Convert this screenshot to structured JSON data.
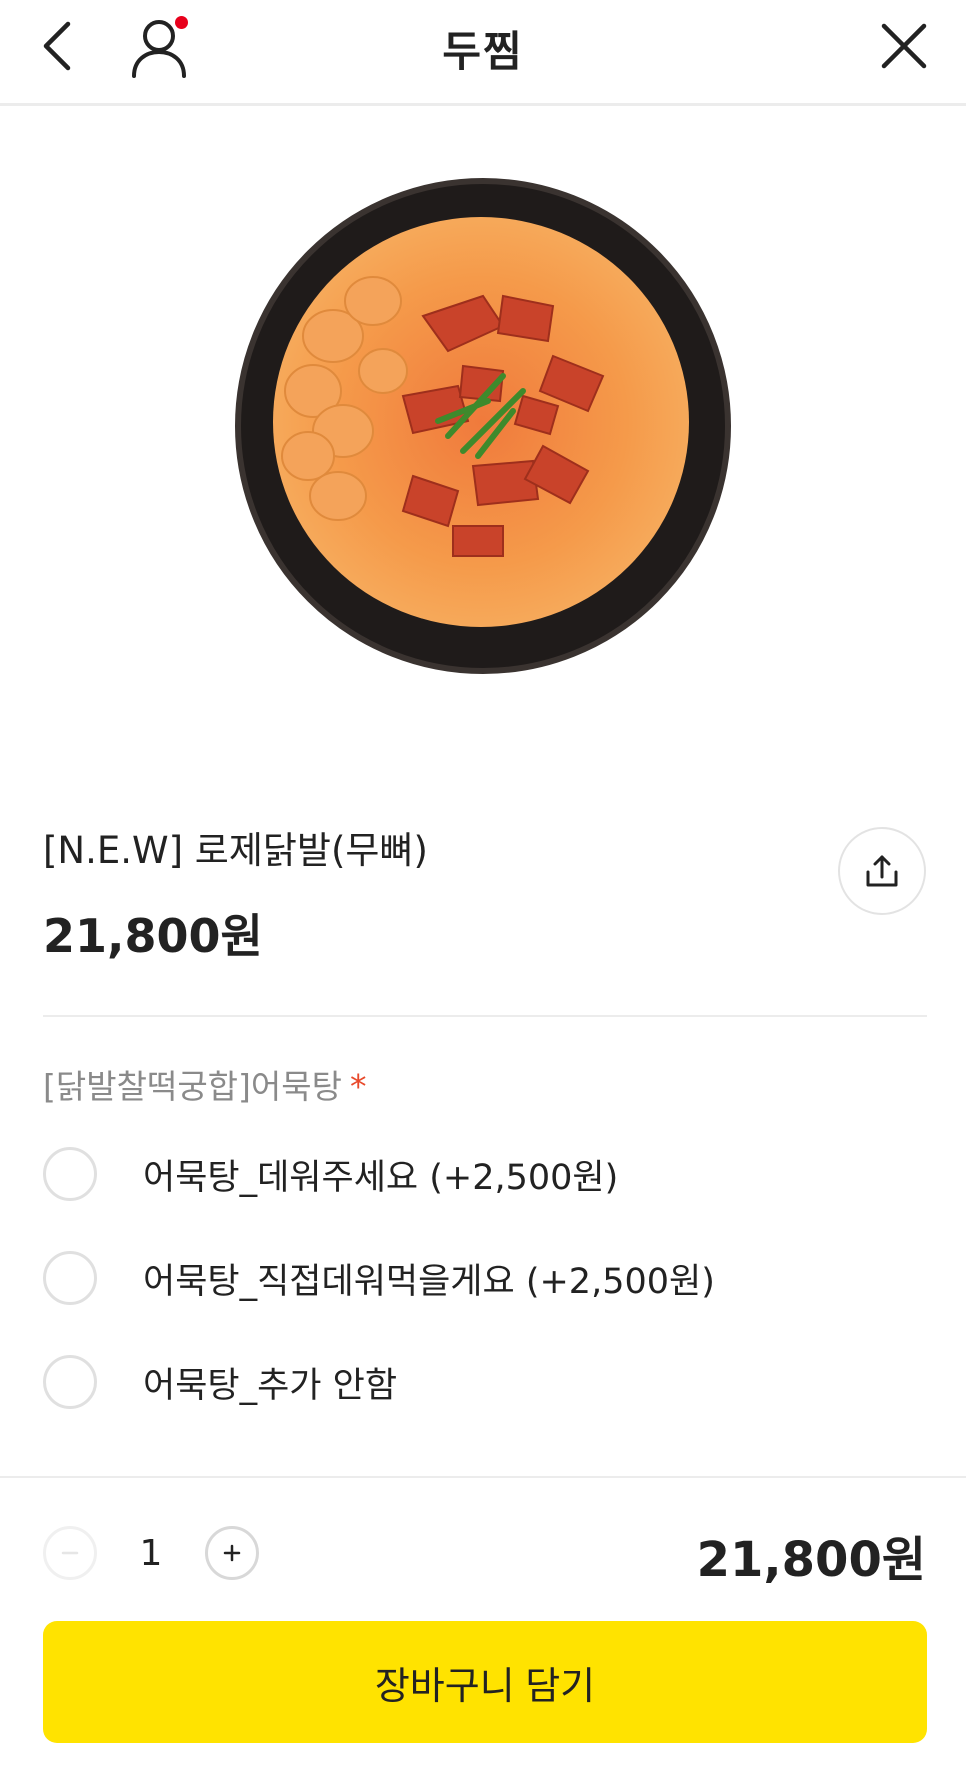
{
  "header": {
    "title": "두찜",
    "icons": {
      "back": "chevron-left-icon",
      "user": "user-icon",
      "close": "close-icon"
    },
    "notification_dot_color": "#e8001c"
  },
  "product": {
    "name": "[N.E.W] 로제닭발(무뼈)",
    "price": "21,800원",
    "image": "rose-chicken-feet-dish-photo"
  },
  "options_section": {
    "title": "[닭발찰떡궁합]어묵탕",
    "required_mark": "*",
    "options": [
      {
        "label": "어묵탕_데워주세요 (+2,500원)",
        "selected": false
      },
      {
        "label": "어묵탕_직접데워먹을게요 (+2,500원)",
        "selected": false
      },
      {
        "label": "어묵탕_추가 안함",
        "selected": false
      }
    ]
  },
  "order": {
    "quantity": "1",
    "total": "21,800원",
    "add_to_cart_label": "장바구니 담기"
  },
  "colors": {
    "accent": "#ffe300",
    "required": "#e8492b"
  }
}
